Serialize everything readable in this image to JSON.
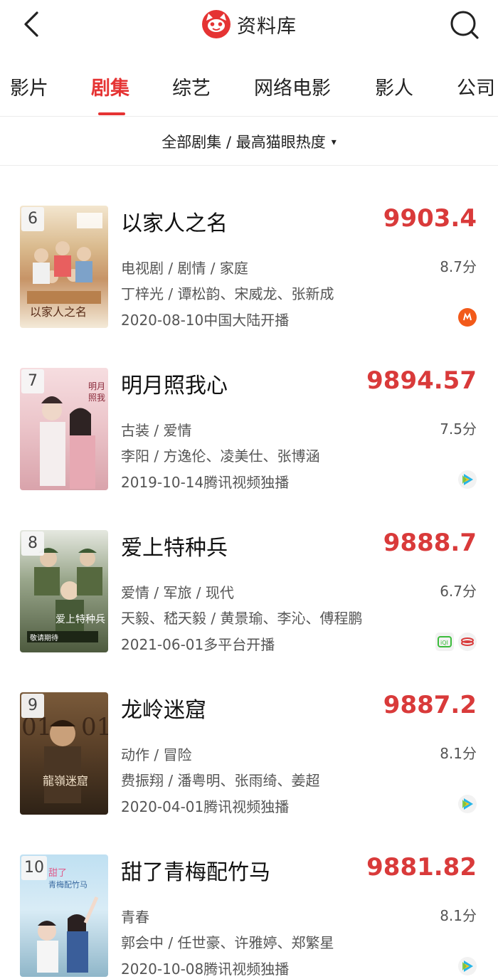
{
  "header": {
    "title": "资料库",
    "back_icon": "chevron-left-icon",
    "search_icon": "search-icon",
    "logo_icon": "maoyan-cat-logo",
    "brand_color": "#e53333"
  },
  "tabs": [
    {
      "label": "影片",
      "active": false
    },
    {
      "label": "剧集",
      "active": true
    },
    {
      "label": "综艺",
      "active": false
    },
    {
      "label": "网络电影",
      "active": false
    },
    {
      "label": "影人",
      "active": false
    },
    {
      "label": "公司",
      "active": false
    }
  ],
  "filter": {
    "label": "全部剧集 / 最高猫眼热度",
    "caret": "▾"
  },
  "items": [
    {
      "rank": "6",
      "title": "以家人之名",
      "score": "9903.4",
      "genres": "电视剧 / 剧情 / 家庭",
      "rating": "8.7分",
      "people": "丁梓光 / 谭松韵、宋威龙、张新成",
      "release": "2020-08-10中国大陆开播",
      "platforms": [
        "mango-tv-icon"
      ]
    },
    {
      "rank": "7",
      "title": "明月照我心",
      "score": "9894.57",
      "genres": "古装 / 爱情",
      "rating": "7.5分",
      "people": "李阳 / 方逸伦、凌美仕、张博涵",
      "release": "2019-10-14腾讯视频独播",
      "platforms": [
        "tencent-video-icon"
      ]
    },
    {
      "rank": "8",
      "title": "爱上特种兵",
      "score": "9888.7",
      "genres": "爱情 / 军旅 / 现代",
      "rating": "6.7分",
      "people": "天毅、嵇天毅 / 黄景瑜、李沁、傅程鹏",
      "release": "2021-06-01多平台开播",
      "platforms": [
        "iqiyi-icon",
        "cctv-icon"
      ]
    },
    {
      "rank": "9",
      "title": "龙岭迷窟",
      "score": "9887.2",
      "genres": "动作 / 冒险",
      "rating": "8.1分",
      "people": "费振翔 / 潘粤明、张雨绮、姜超",
      "release": "2020-04-01腾讯视频独播",
      "platforms": [
        "tencent-video-icon"
      ]
    },
    {
      "rank": "10",
      "title": "甜了青梅配竹马",
      "score": "9881.82",
      "genres": "青春",
      "rating": "8.1分",
      "people": "郭会中 / 任世豪、许雅婷、郑繁星",
      "release": "2020-10-08腾讯视频独播",
      "platforms": [
        "tencent-video-icon"
      ]
    }
  ]
}
